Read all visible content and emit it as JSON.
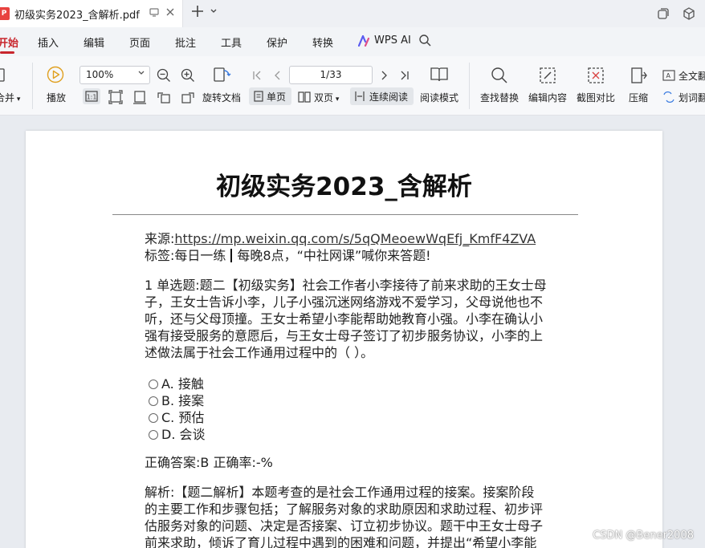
{
  "tab": {
    "title": "初级实务2023_含解析.pdf",
    "icon_glyph": "P"
  },
  "menu": {
    "items": [
      "开始",
      "插入",
      "编辑",
      "页面",
      "批注",
      "工具",
      "保护",
      "转换",
      "WPS AI"
    ]
  },
  "toolbar": {
    "merge_label": "合并",
    "play_label": "播放",
    "zoom_value": "100%",
    "rotate_label": "旋转文档",
    "single_page_label": "单页",
    "double_page_label": "双页",
    "continuous_label": "连续阅读",
    "read_mode_label": "阅读模式",
    "page_indicator": "1/33",
    "find_replace_label": "查找替换",
    "edit_content_label": "编辑内容",
    "screenshot_compare_label": "截图对比",
    "compress_label": "压缩",
    "full_translate_label": "全文翻",
    "word_translate_label": "划词翻"
  },
  "document": {
    "title": "初级实务2023_含解析",
    "source_label": "来源:",
    "source_url": "https://mp.weixin.qq.com/s/5qQMeoewWqEfj_KmfF4ZVA",
    "tags_label": "标签:",
    "tag_1": "每日一练",
    "tag_2": "每晚8点，“中社网课”喊你来答题!",
    "question_lines": [
      "1 单选题:题二【初级实务】社会工作者小李接待了前来求助的王女士母",
      "子，王女士告诉小李，儿子小强沉迷网络游戏不爱学习，父母说他也不",
      "听，还与父母顶撞。王女士希望小李能帮助她教育小强。小李在确认小",
      "强有接受服务的意愿后，与王女士母子签订了初步服务协议，小李的上",
      "述做法属于社会工作通用过程中的（ ）。"
    ],
    "options": [
      "A. 接触",
      "B. 接案",
      "C. 预估",
      "D. 会谈"
    ],
    "answer_line": "正确答案:B 正确率:-%",
    "analysis_lines": [
      "解析:【题二解析】本题考查的是社会工作通用过程的接案。接案阶段",
      "的主要工作和步骤包括；了解服务对象的求助原因和求助过程、初步评",
      "估服务对象的问题、决定是否接案、订立初步协议。题干中王女士母子",
      "前来求助，倾诉了育儿过程中遇到的困难和问题，并提出“希望小李能"
    ]
  },
  "watermark": "CSDN @Bener2008",
  "colors": {
    "accent_red": "#c8262d",
    "toolbar_bg": "#f7f8fa",
    "canvas_bg": "#e8ebf0",
    "pdf_icon": "#e8423f"
  }
}
